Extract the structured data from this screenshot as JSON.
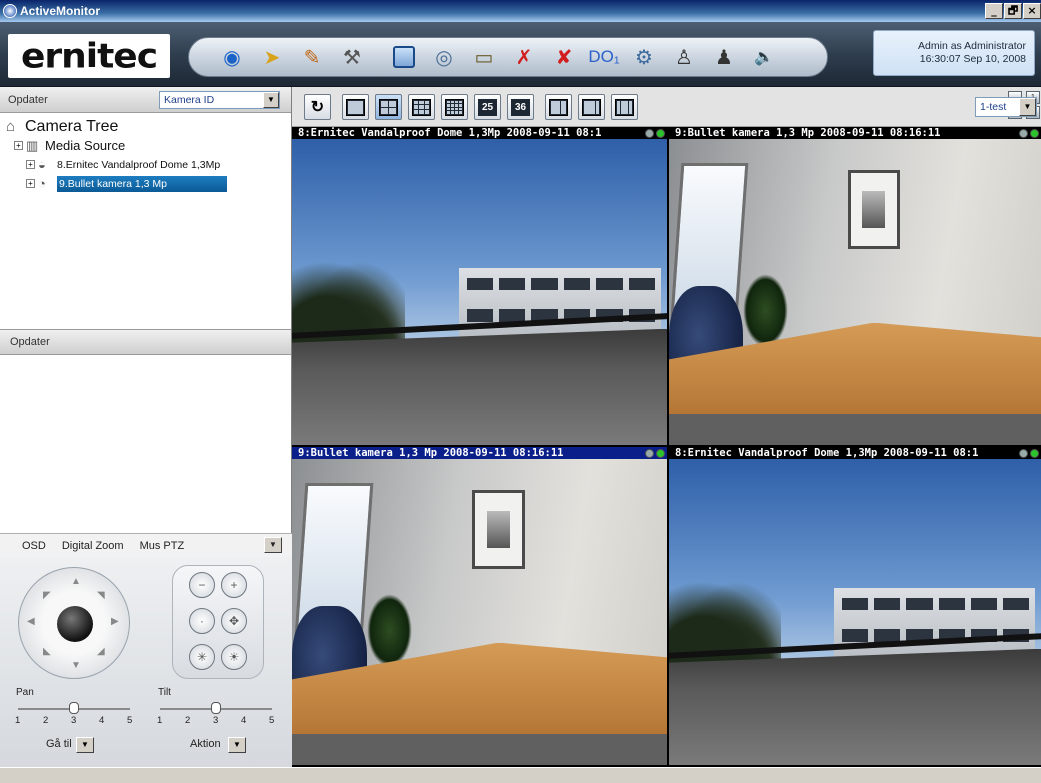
{
  "window": {
    "title": "ActiveMonitor",
    "buttons": [
      "_",
      "🗗",
      "×"
    ]
  },
  "brand": {
    "logo_text": "ernitec"
  },
  "toolbar": {
    "icons": [
      "eye-icon",
      "tag-icon",
      "wand-icon",
      "hammer-icon",
      "fullscreen-icon",
      "camera-icon",
      "monitor-icon",
      "cancel-red-icon",
      "cancel-multi-icon",
      "do-output-icon",
      "settings-chip-icon",
      "operator-icon",
      "operator-group-icon",
      "speaker-icon"
    ],
    "do_label": "DO₁",
    "accent": "#1a4a8a"
  },
  "user": {
    "line1": "Admin as Administrator",
    "line2": "16:30:07 Sep 10, 2008"
  },
  "left_panel": {
    "header_label": "Opdater",
    "filter_value": "Kamera ID",
    "tree_title": "Camera Tree",
    "media_source": "Media Source",
    "cameras": [
      "8.Ernitec Vandalproof Dome 1,3Mp",
      "9.Bullet kamera 1,3 Mp"
    ],
    "selected_index": 1,
    "second_header": "Opdater"
  },
  "ptz": {
    "tabs": [
      "OSD",
      "Digital Zoom",
      "Mus PTZ"
    ],
    "pan_label": "Pan",
    "tilt_label": "Tilt",
    "pan_value": 3,
    "tilt_value": 3,
    "ticks": [
      "1",
      "2",
      "3",
      "4",
      "5"
    ],
    "goto_label": "Gå til",
    "action_label": "Aktion"
  },
  "layoutbar": {
    "num25": "25",
    "num36": "36",
    "preset": "1-test",
    "small_grid": [
      "",
      "1",
      "2",
      "Q",
      "3",
      "4"
    ]
  },
  "tiles": [
    {
      "caption": "8:Ernitec Vandalproof Dome 1,3Mp   2008-09-11 08:1",
      "scene": "outdoor",
      "blue": false
    },
    {
      "caption": "9:Bullet kamera 1,3 Mp   2008-09-11 08:16:11",
      "scene": "indoor",
      "blue": false
    },
    {
      "caption": "9:Bullet kamera 1,3 Mp   2008-09-11 08:16:11",
      "scene": "indoor",
      "blue": true
    },
    {
      "caption": "8:Ernitec Vandalproof Dome 1,3Mp   2008-09-11 08:1",
      "scene": "outdoor",
      "blue": false
    }
  ]
}
